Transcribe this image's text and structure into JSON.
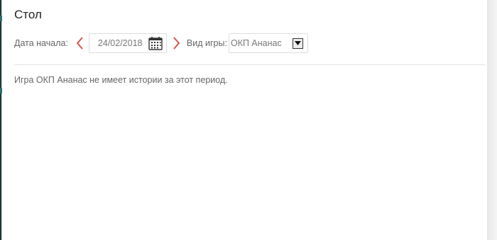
{
  "page": {
    "title": "Стол"
  },
  "toolbar": {
    "start_date_label": "Дата начала:",
    "start_date_value": "24/02/2018",
    "prev_icon": "chevron-left-icon",
    "next_icon": "chevron-right-icon",
    "calendar_icon": "calendar-icon",
    "game_type_label": "Вид игры:",
    "game_type_selected": "ОКП Ананас"
  },
  "content": {
    "message": "Игра ОКП Ананас не имеет истории за этот период."
  },
  "colors": {
    "accent_arrow": "#d9534f",
    "divider": "#e2e2e2"
  }
}
